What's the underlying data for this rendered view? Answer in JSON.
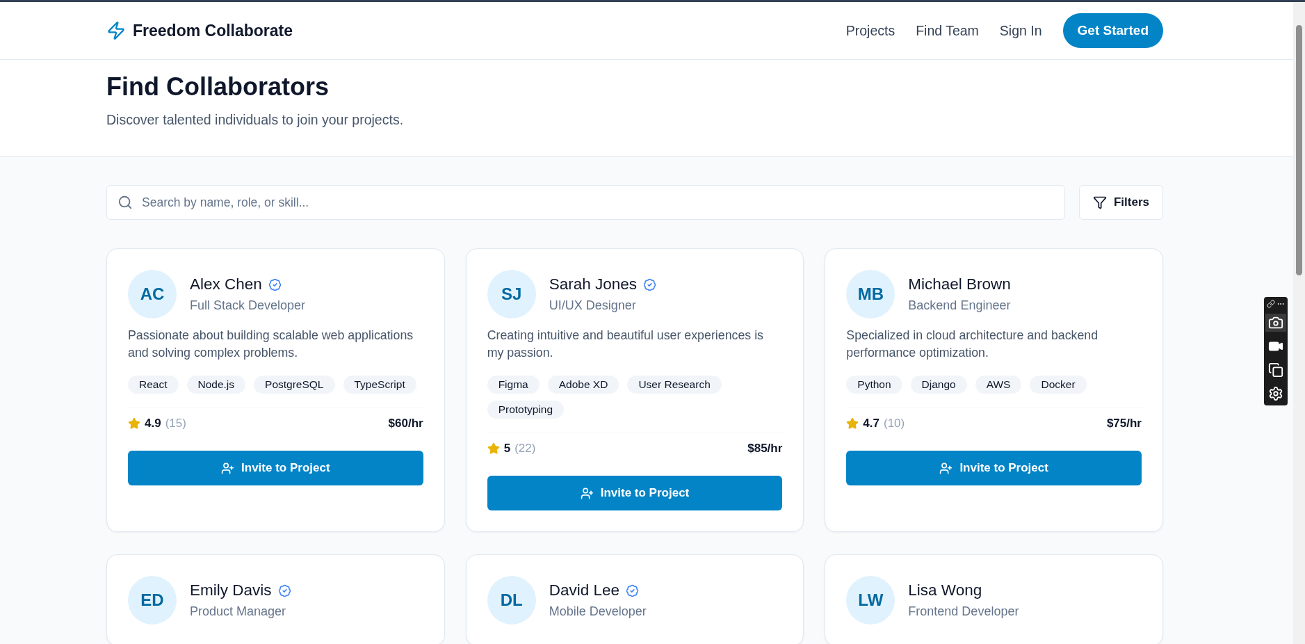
{
  "brand": {
    "name": "Freedom Collaborate"
  },
  "nav": {
    "links": [
      "Projects",
      "Find Team",
      "Sign In"
    ],
    "cta": "Get Started"
  },
  "hero": {
    "title": "Find Collaborators",
    "subtitle": "Discover talented individuals to join your projects."
  },
  "search": {
    "placeholder": "Search by name, role, or skill..."
  },
  "filters_button": "Filters",
  "people": [
    {
      "initials": "AC",
      "name": "Alex Chen",
      "verified": true,
      "role": "Full Stack Developer",
      "bio": "Passionate about building scalable web applications and solving complex problems.",
      "skills": [
        "React",
        "Node.js",
        "PostgreSQL",
        "TypeScript"
      ],
      "rating": "4.9",
      "reviews": "(15)",
      "rate": "$60/hr",
      "action": "Invite to Project"
    },
    {
      "initials": "SJ",
      "name": "Sarah Jones",
      "verified": true,
      "role": "UI/UX Designer",
      "bio": "Creating intuitive and beautiful user experiences is my passion.",
      "skills": [
        "Figma",
        "Adobe XD",
        "User Research",
        "Prototyping"
      ],
      "rating": "5",
      "reviews": "(22)",
      "rate": "$85/hr",
      "action": "Invite to Project"
    },
    {
      "initials": "MB",
      "name": "Michael Brown",
      "verified": false,
      "role": "Backend Engineer",
      "bio": "Specialized in cloud architecture and backend performance optimization.",
      "skills": [
        "Python",
        "Django",
        "AWS",
        "Docker"
      ],
      "rating": "4.7",
      "reviews": "(10)",
      "rate": "$75/hr",
      "action": "Invite to Project"
    },
    {
      "initials": "ED",
      "name": "Emily Davis",
      "verified": true,
      "role": "Product Manager"
    },
    {
      "initials": "DL",
      "name": "David Lee",
      "verified": true,
      "role": "Mobile Developer"
    },
    {
      "initials": "LW",
      "name": "Lisa Wong",
      "verified": false,
      "role": "Frontend Developer"
    }
  ]
}
